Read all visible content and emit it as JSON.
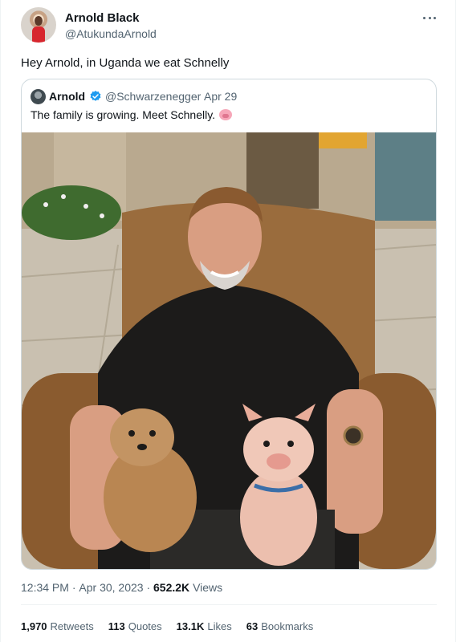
{
  "author": {
    "name": "Arnold Black",
    "handle": "@AtukundaArnold"
  },
  "tweet": {
    "text": "Hey Arnold, in Uganda we eat Schnelly",
    "time": "12:34 PM",
    "separator": "·",
    "date": "Apr 30, 2023",
    "views_count": "652.2K",
    "views_label": "Views"
  },
  "quoted": {
    "name": "Arnold",
    "handle": "@Schwarzenegger",
    "separator": "·",
    "date": "Apr 29",
    "text": "The family is growing. Meet Schnelly.",
    "emoji": "pig-face-icon",
    "verified_color": "#1d9bf0"
  },
  "stats": [
    {
      "count": "1,970",
      "label": "Retweets"
    },
    {
      "count": "113",
      "label": "Quotes"
    },
    {
      "count": "13.1K",
      "label": "Likes"
    },
    {
      "count": "63",
      "label": "Bookmarks"
    }
  ],
  "icons": {
    "more": "more-dots-icon",
    "verified": "verified-badge-icon"
  }
}
